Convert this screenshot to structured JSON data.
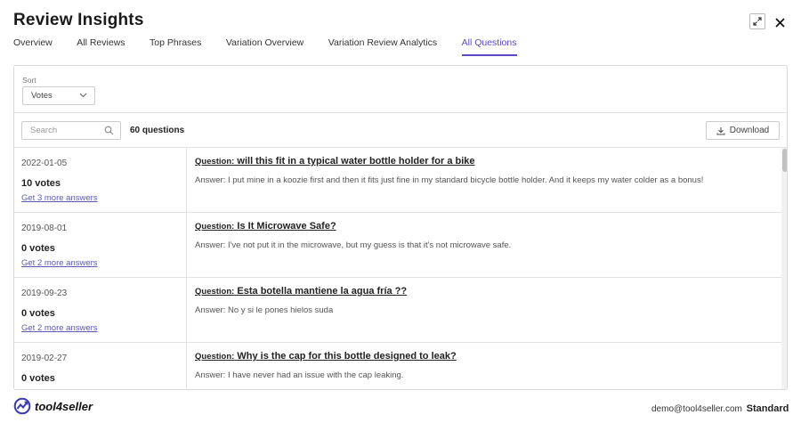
{
  "header": {
    "title": "Review Insights",
    "expand_icon": "expand-icon",
    "close_icon": "close-icon"
  },
  "tabs": [
    {
      "label": "Overview",
      "active": false
    },
    {
      "label": "All Reviews",
      "active": false
    },
    {
      "label": "Top Phrases",
      "active": false
    },
    {
      "label": "Variation Overview",
      "active": false
    },
    {
      "label": "Variation Review Analytics",
      "active": false
    },
    {
      "label": "All Questions",
      "active": true
    }
  ],
  "sort": {
    "label": "Sort",
    "value": "Votes"
  },
  "toolbar": {
    "search_placeholder": "Search",
    "count_label": "60 questions",
    "download_label": "Download"
  },
  "question_prefix": "Question:",
  "questions": [
    {
      "date": "2022-01-05",
      "votes": "10 votes",
      "more": "Get 3 more answers",
      "question": "will this fit in a typical water bottle holder for a bike",
      "answer": "Answer: I put mine in a koozie first and then it fits just fine in my standard bicycle bottle holder. And it keeps my water colder as a bonus!"
    },
    {
      "date": "2019-08-01",
      "votes": "0 votes",
      "more": "Get 2 more answers",
      "question": "Is It Microwave Safe?",
      "answer": "Answer: I've not put it in the microwave, but my guess is that it's not microwave safe."
    },
    {
      "date": "2019-09-23",
      "votes": "0 votes",
      "more": "Get 2 more answers",
      "question": "Esta botella mantiene la agua fría ??",
      "answer": "Answer: No y si le pones hielos suda"
    },
    {
      "date": "2019-02-27",
      "votes": "0 votes",
      "more": "",
      "question": "Why is the cap for this bottle designed to leak?",
      "answer": "Answer: I have never had an issue with the cap leaking."
    }
  ],
  "footer": {
    "brand": "tool4seller",
    "email": "demo@tool4seller.com",
    "plan": "Standard"
  },
  "colors": {
    "accent": "#5b4bc4",
    "link": "#5b5bb5",
    "border": "#d9d9d9"
  }
}
